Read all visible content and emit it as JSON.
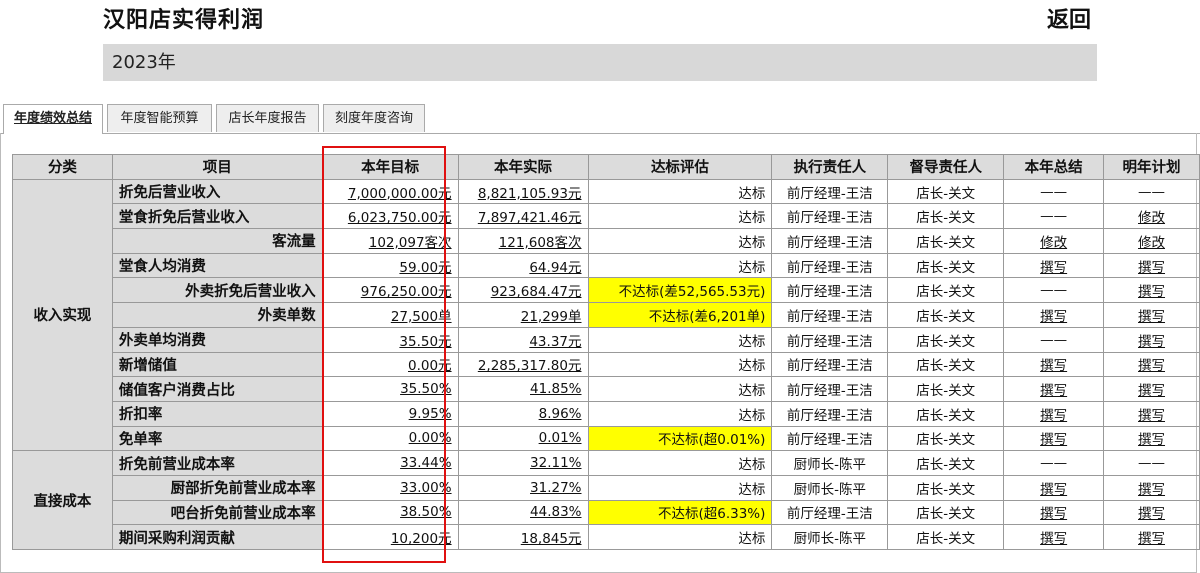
{
  "page": {
    "title": "汉阳店实得利润",
    "back_label": "返回",
    "year": "2023年"
  },
  "tabs": [
    {
      "label": "年度绩效总结"
    },
    {
      "label": "年度智能预算"
    },
    {
      "label": "店长年度报告"
    },
    {
      "label": "刻度年度咨询"
    }
  ],
  "table": {
    "headers": [
      "分类",
      "项目",
      "本年目标",
      "本年实际",
      "达标评估",
      "执行责任人",
      "督导责任人",
      "本年总结",
      "明年计划"
    ],
    "categories": [
      "收入实现",
      "直接成本"
    ],
    "rows": [
      {
        "item": "折免后营业收入",
        "target": "7,000,000.00元",
        "actual": "8,821,105.93元",
        "eval": "达标",
        "exec": "前厅经理-王洁",
        "supervisor": "店长-关文",
        "summary": "——",
        "plan": "——"
      },
      {
        "item": "堂食折免后营业收入",
        "target": "6,023,750.00元",
        "actual": "7,897,421.46元",
        "eval": "达标",
        "exec": "前厅经理-王洁",
        "supervisor": "店长-关文",
        "summary": "——",
        "plan": "修改"
      },
      {
        "item": "客流量",
        "target": "102,097客次",
        "actual": "121,608客次",
        "eval": "达标",
        "exec": "前厅经理-王洁",
        "supervisor": "店长-关文",
        "summary": "修改",
        "plan": "修改"
      },
      {
        "item": "堂食人均消费",
        "target": "59.00元",
        "actual": "64.94元",
        "eval": "达标",
        "exec": "前厅经理-王洁",
        "supervisor": "店长-关文",
        "summary": "撰写",
        "plan": "撰写"
      },
      {
        "item": "外卖折免后营业收入",
        "target": "976,250.00元",
        "actual": "923,684.47元",
        "eval": "不达标(差52,565.53元)",
        "exec": "前厅经理-王洁",
        "supervisor": "店长-关文",
        "summary": "——",
        "plan": "撰写"
      },
      {
        "item": "外卖单数",
        "target": "27,500单",
        "actual": "21,299单",
        "eval": "不达标(差6,201单)",
        "exec": "前厅经理-王洁",
        "supervisor": "店长-关文",
        "summary": "撰写",
        "plan": "撰写"
      },
      {
        "item": "外卖单均消费",
        "target": "35.50元",
        "actual": "43.37元",
        "eval": "达标",
        "exec": "前厅经理-王洁",
        "supervisor": "店长-关文",
        "summary": "——",
        "plan": "撰写"
      },
      {
        "item": "新增储值",
        "target": "0.00元",
        "actual": "2,285,317.80元",
        "eval": "达标",
        "exec": "前厅经理-王洁",
        "supervisor": "店长-关文",
        "summary": "撰写",
        "plan": "撰写"
      },
      {
        "item": "储值客户消费占比",
        "target": "35.50%",
        "actual": "41.85%",
        "eval": "达标",
        "exec": "前厅经理-王洁",
        "supervisor": "店长-关文",
        "summary": "撰写",
        "plan": "撰写"
      },
      {
        "item": "折扣率",
        "target": "9.95%",
        "actual": "8.96%",
        "eval": "达标",
        "exec": "前厅经理-王洁",
        "supervisor": "店长-关文",
        "summary": "撰写",
        "plan": "撰写"
      },
      {
        "item": "免单率",
        "target": "0.00%",
        "actual": "0.01%",
        "eval": "不达标(超0.01%)",
        "exec": "前厅经理-王洁",
        "supervisor": "店长-关文",
        "summary": "撰写",
        "plan": "撰写"
      },
      {
        "item": "折免前营业成本率",
        "target": "33.44%",
        "actual": "32.11%",
        "eval": "达标",
        "exec": "厨师长-陈平",
        "supervisor": "店长-关文",
        "summary": "——",
        "plan": "——"
      },
      {
        "item": "厨部折免前营业成本率",
        "target": "33.00%",
        "actual": "31.27%",
        "eval": "达标",
        "exec": "厨师长-陈平",
        "supervisor": "店长-关文",
        "summary": "撰写",
        "plan": "撰写"
      },
      {
        "item": "吧台折免前营业成本率",
        "target": "38.50%",
        "actual": "44.83%",
        "eval": "不达标(超6.33%)",
        "exec": "前厅经理-王洁",
        "supervisor": "店长-关文",
        "summary": "撰写",
        "plan": "撰写"
      },
      {
        "item": "期间采购利润贡献",
        "target": "10,200元",
        "actual": "18,845元",
        "eval": "达标",
        "exec": "厨师长-陈平",
        "supervisor": "店长-关文",
        "summary": "撰写",
        "plan": "撰写"
      }
    ]
  },
  "colors": {
    "warn": "#ffff00",
    "highlight_border": "#e01010",
    "header_bg": "#dcdcdc",
    "year_bar": "#d8d8d8"
  }
}
